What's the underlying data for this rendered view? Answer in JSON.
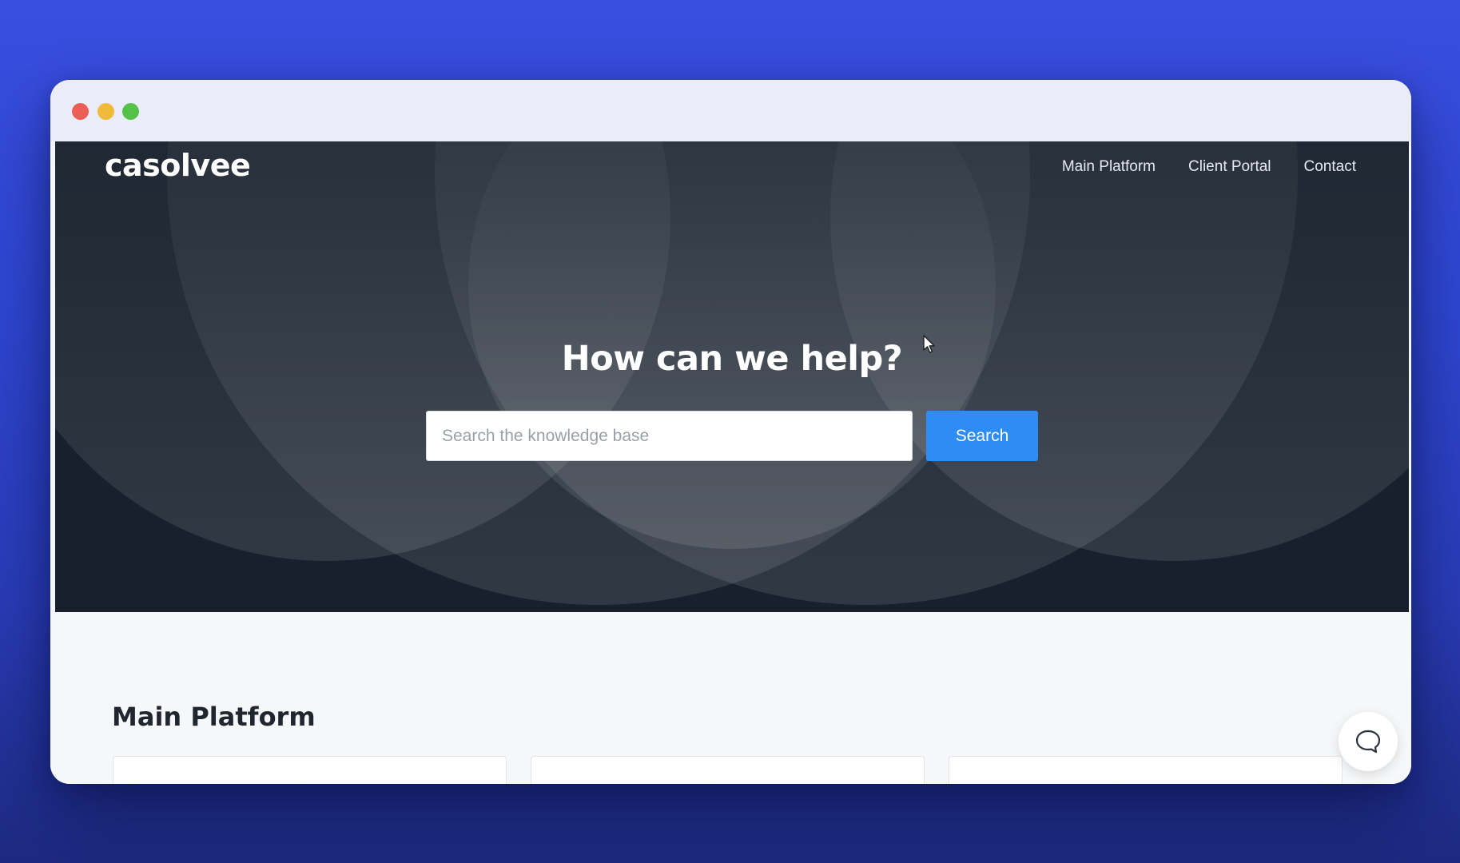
{
  "brand": {
    "logo_text": "casolvee"
  },
  "nav": {
    "links": [
      "Main Platform",
      "Client Portal",
      "Contact"
    ]
  },
  "hero": {
    "title": "How can we help?",
    "search_placeholder": "Search the knowledge base",
    "search_value": "",
    "search_button": "Search"
  },
  "section": {
    "title": "Main Platform"
  },
  "icons": {
    "chat": "chat-bubble-icon",
    "cursor": "mouse-pointer-icon"
  },
  "colors": {
    "hero_background": "#17202c",
    "accent": "#2e8cf6",
    "page_background": "#f6f7f8",
    "desktop_background": "#3a4ee0"
  }
}
